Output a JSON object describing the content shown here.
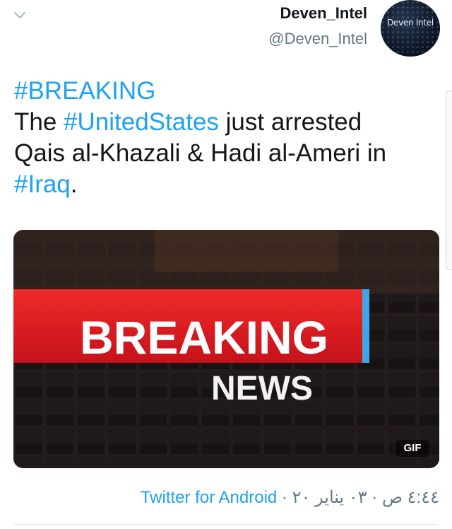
{
  "author": {
    "display_name": "Deven_Intel",
    "handle": "@Deven_Intel",
    "avatar_text": "Deven Intel"
  },
  "tweet": {
    "line1_hashtag": "#BREAKING",
    "line2_pre": "The ",
    "line2_hashtag": "#UnitedStates",
    "line2_post": " just arrested",
    "line3": "Qais al-Khazali & Hadi al-Ameri in",
    "line4_hashtag": "#Iraq",
    "line4_post": "."
  },
  "media": {
    "banner_word1": "BREAKING",
    "banner_word2": "NEWS",
    "badge": "GIF"
  },
  "meta": {
    "source": "Twitter for Android",
    "separator": " · ",
    "timestamp": "٤:٤٤ ص · ٠٣ يناير ٢٠"
  },
  "icons": {
    "chevron": "chevron-down-icon"
  },
  "colors": {
    "link": "#1da1f2",
    "text": "#14171a",
    "muted": "#657786",
    "banner_red": "#e0191f"
  }
}
